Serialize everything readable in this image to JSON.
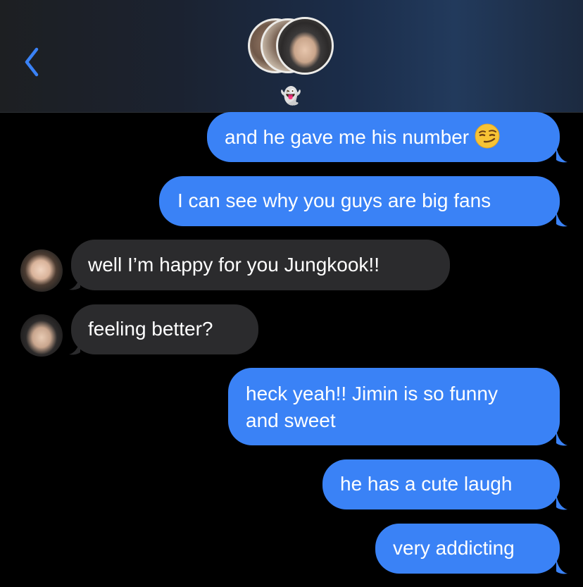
{
  "header": {
    "back_icon": "chevron-left-icon",
    "group_emoji": "👻",
    "accent_color": "#3a82f6"
  },
  "messages": [
    {
      "sender": "me",
      "text": "and he gave me his number",
      "emoji": "😏"
    },
    {
      "sender": "me",
      "text": "I can see why you guys are big fans"
    },
    {
      "sender": "them",
      "text": "well I’m happy for you Jungkook!!"
    },
    {
      "sender": "them",
      "text": "feeling better?"
    },
    {
      "sender": "me",
      "lines": [
        "heck yeah!! Jimin is so funny",
        "and sweet"
      ]
    },
    {
      "sender": "me",
      "text": "he has a cute laugh"
    },
    {
      "sender": "me",
      "text": "very addicting"
    }
  ],
  "colors": {
    "outgoing_bubble": "#3a82f6",
    "incoming_bubble": "#2b2b2d",
    "background": "#000000"
  }
}
